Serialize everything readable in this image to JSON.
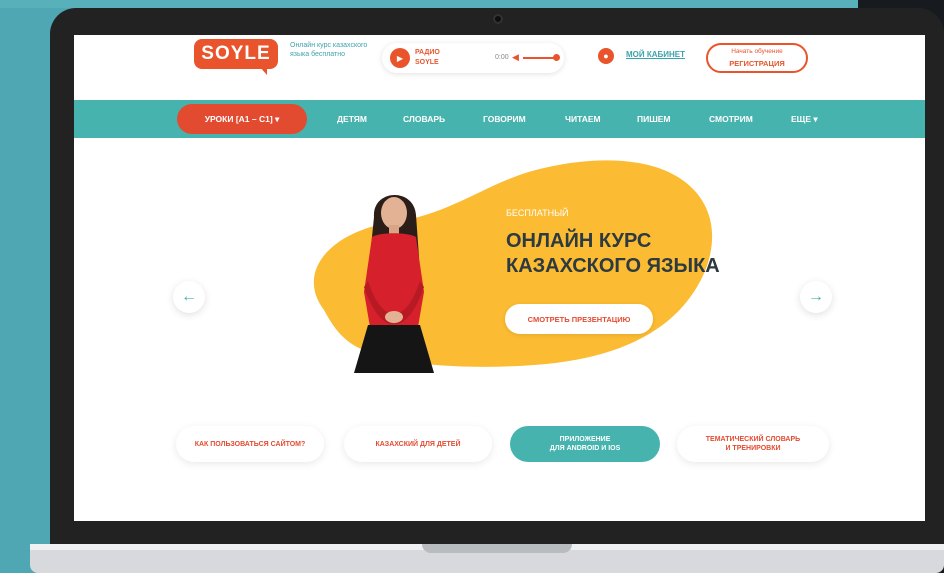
{
  "header": {
    "logo": "SOYLE",
    "tagline": "Онлайн курс казахского языка бесплатно",
    "radio_label_line1": "РАДИО",
    "radio_label_line2": "SOYLE",
    "radio_time": "0:00",
    "cabinet_link": "МОЙ КАБИНЕТ",
    "register_sub": "Начать обучение",
    "register_main": "РЕГИСТРАЦИЯ"
  },
  "nav": {
    "lessons": "УРОКИ [A1 – C1] ▾",
    "items": [
      "ДЕТЯМ",
      "СЛОВАРЬ",
      "ГОВОРИМ",
      "ЧИТАЕМ",
      "ПИШЕМ",
      "СМОТРИМ",
      "ЕЩЕ ▾"
    ]
  },
  "hero": {
    "kicker": "БЕСПЛАТНЫЙ",
    "title_line1": "ОНЛАЙН КУРС",
    "title_line2": "КАЗАХСКОГО ЯЗЫКА",
    "cta": "СМОТРЕТЬ ПРЕЗЕНТАЦИЮ"
  },
  "links": [
    {
      "label": "КАК ПОЛЬЗОВАТЬСЯ САЙТОМ?",
      "active": false
    },
    {
      "label": "КАЗАХСКИЙ ДЛЯ ДЕТЕЙ",
      "active": false
    },
    {
      "label_line1": "ПРИЛОЖЕНИЕ",
      "label_line2": "ДЛЯ ANDROID И IOS",
      "active": true
    },
    {
      "label_line1": "ТЕМАТИЧЕСКИЙ СЛОВАРЬ",
      "label_line2": "И ТРЕНИРОВКИ",
      "active": false
    }
  ],
  "icons": {
    "prev": "arrow-left-icon",
    "next": "arrow-right-icon",
    "play": "play-icon",
    "volume": "volume-icon",
    "user": "user-icon"
  },
  "colors": {
    "accent_orange": "#e34b30",
    "teal": "#46b3ae",
    "yellow": "#fbbb32",
    "background": "#4ea7b3"
  }
}
